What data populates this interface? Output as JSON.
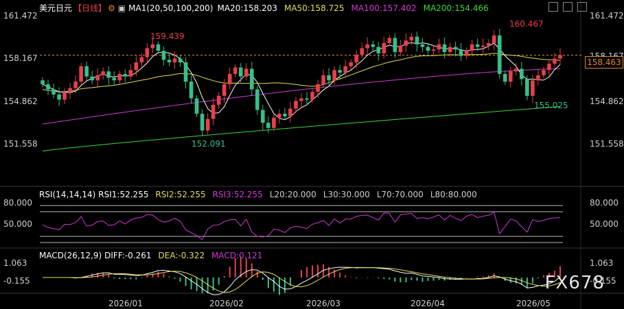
{
  "header": {
    "symbol": "美元日元",
    "period": "【日线】",
    "ma_label": "MA1(20,50,100,200)",
    "ma20": "MA20:158.203",
    "ma50": "MA50:158.725",
    "ma100": "MA100:157.402",
    "ma200": "MA200:154.466"
  },
  "price_axis": {
    "left": [
      "161.472",
      "158.167",
      "154.862",
      "151.558"
    ],
    "right": [
      "161.472",
      "158.167",
      "154.862",
      "151.558"
    ]
  },
  "current_price": "158.463",
  "annotations": {
    "high1": "159.439",
    "low1": "152.091",
    "high2": "160.467",
    "low2": "155.025"
  },
  "rsi": {
    "label": "RSI(14,14,14)",
    "rsi1": "RSI1:52.255",
    "rsi2": "RSI2:52.255",
    "rsi3": "RSI3:52.255",
    "l20": "L20:20.000",
    "l30": "L30:30.000",
    "l70": "L70:70.000",
    "l80": "L80:80.000",
    "axis_left": [
      "80.000",
      "50.000"
    ],
    "axis_right": [
      "80.000",
      "50.000"
    ]
  },
  "macd": {
    "label": "MACD(26,12,9)",
    "diff": "DIFF:-0.261",
    "dea": "DEA:-0.322",
    "macd": "MACD:0.121",
    "axis_left": [
      "1.063",
      "-0.155"
    ],
    "axis_right": [
      "1.063",
      "-0.155"
    ]
  },
  "x_axis": [
    "2026/01",
    "2026/02",
    "2026/03",
    "2026/04",
    "2026/05"
  ],
  "watermark": "FX678",
  "colors": {
    "up": "#e8404a",
    "down": "#36c08a",
    "ma20": "#ffffff",
    "ma50": "#e6df57",
    "ma100": "#d23ad6",
    "ma200": "#3dd93a",
    "rsi": "#d23ad6",
    "diff": "#ffffff",
    "dea": "#e6df57",
    "price_line": "#e08a2e"
  },
  "chart_data": {
    "type": "candlestick",
    "symbol": "USD/JPY",
    "ylim": [
      151.558,
      161.472
    ],
    "annotated_extremes": [
      {
        "label": "159.439",
        "kind": "high"
      },
      {
        "label": "152.091",
        "kind": "low"
      },
      {
        "label": "160.467",
        "kind": "high"
      },
      {
        "label": "155.025",
        "kind": "low"
      }
    ],
    "close_path": [
      156.2,
      155.8,
      155.4,
      155.0,
      155.6,
      155.9,
      156.4,
      157.6,
      156.8,
      156.5,
      156.9,
      157.2,
      156.7,
      156.5,
      157.0,
      156.8,
      157.3,
      157.9,
      158.3,
      159.0,
      159.3,
      158.8,
      158.1,
      157.9,
      158.2,
      157.9,
      156.4,
      155.1,
      153.9,
      152.6,
      153.5,
      154.6,
      155.3,
      156.2,
      157.0,
      157.5,
      156.8,
      157.4,
      155.8,
      154.2,
      153.2,
      152.8,
      153.6,
      153.9,
      153.7,
      154.3,
      154.9,
      155.1,
      155.0,
      155.6,
      156.2,
      156.9,
      156.5,
      157.3,
      157.1,
      157.6,
      157.9,
      158.5,
      159.0,
      159.3,
      159.1,
      158.6,
      159.4,
      159.8,
      158.7,
      159.2,
      159.6,
      159.9,
      159.3,
      159.1,
      158.8,
      158.9,
      159.3,
      158.7,
      159.1,
      158.9,
      158.4,
      158.8,
      159.3,
      159.1,
      159.2,
      159.4,
      160.0,
      157.0,
      156.4,
      157.2,
      157.4,
      156.6,
      155.3,
      156.5,
      156.9,
      157.3,
      157.8,
      158.2,
      158.46
    ]
  }
}
